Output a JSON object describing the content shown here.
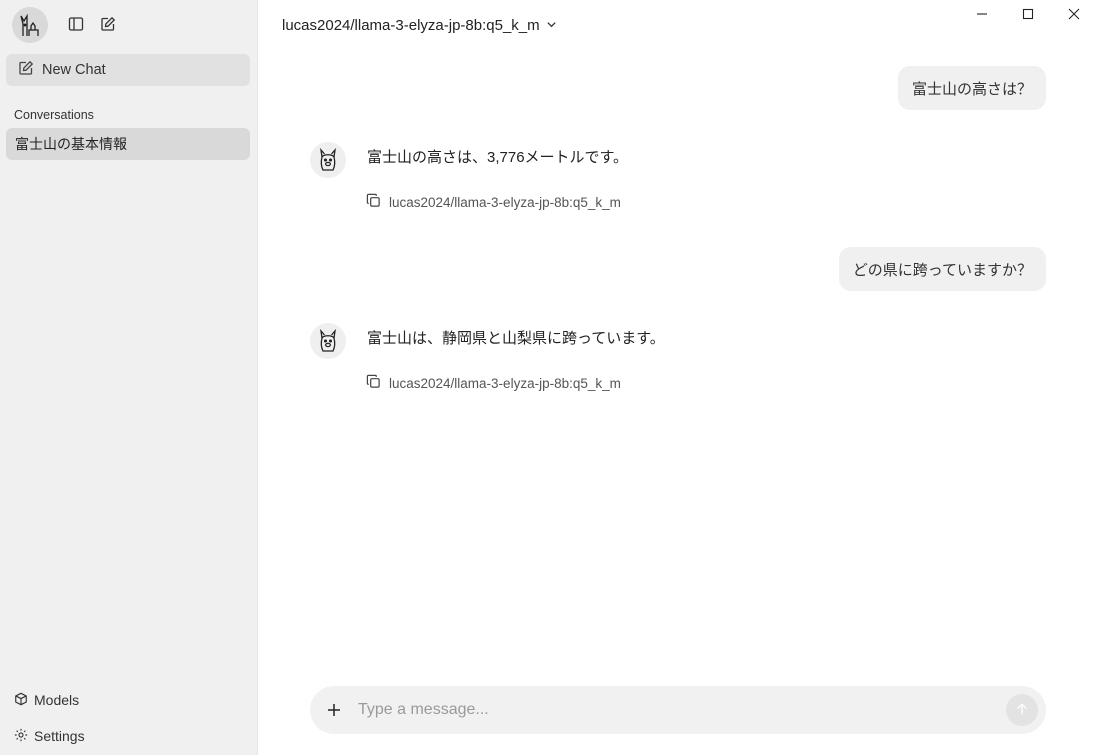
{
  "sidebar": {
    "new_chat_label": "New Chat",
    "section_label": "Conversations",
    "conversations": [
      {
        "title": "富士山の基本情報"
      }
    ],
    "models_label": "Models",
    "settings_label": "Settings"
  },
  "header": {
    "model_name": "lucas2024/llama-3-elyza-jp-8b:q5_k_m"
  },
  "messages": [
    {
      "role": "user",
      "text": "富士山の高さは？"
    },
    {
      "role": "assistant",
      "text": "富士山の高さは、3,776メートルです。",
      "model": "lucas2024/llama-3-elyza-jp-8b:q5_k_m"
    },
    {
      "role": "user",
      "text": "どの県に跨っていますか？"
    },
    {
      "role": "assistant",
      "text": "富士山は、静岡県と山梨県に跨っています。",
      "model": "lucas2024/llama-3-elyza-jp-8b:q5_k_m"
    }
  ],
  "composer": {
    "placeholder": "Type a message..."
  },
  "icons": {
    "avatar": "llama-user-icon",
    "toggle_sidebar": "sidebar-toggle-icon",
    "compose": "compose-icon",
    "copy": "copy-icon",
    "models": "cube-icon",
    "settings": "gear-icon",
    "send": "arrow-up-icon",
    "attach": "plus-icon"
  }
}
